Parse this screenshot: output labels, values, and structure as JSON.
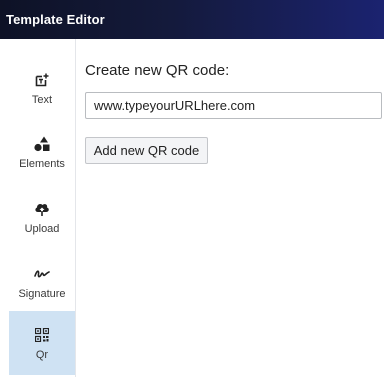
{
  "window": {
    "title": "Template Editor"
  },
  "sidebar": {
    "items": [
      {
        "label": "Text",
        "icon": "text-add-icon"
      },
      {
        "label": "Elements",
        "icon": "shapes-icon"
      },
      {
        "label": "Upload",
        "icon": "cloud-upload-icon"
      },
      {
        "label": "Signature",
        "icon": "signature-icon"
      },
      {
        "label": "Qr",
        "icon": "qr-code-icon",
        "active": true
      }
    ]
  },
  "main": {
    "heading": "Create new QR code:",
    "url_input": {
      "value": "www.typeyourURLhere.com"
    },
    "add_button_label": "Add new QR code"
  },
  "colors": {
    "titlebar_start": "#0e1226",
    "titlebar_end": "#1b2370",
    "active_sidebar_bg": "#cfe2f3"
  }
}
